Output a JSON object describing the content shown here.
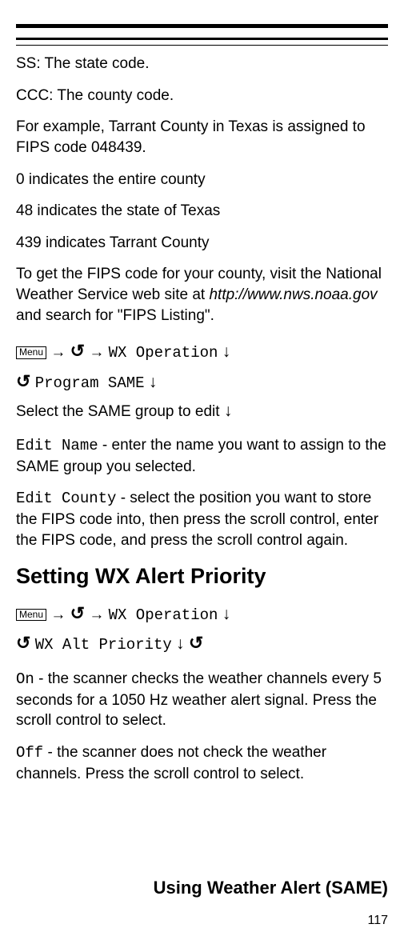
{
  "menu_label": "Menu",
  "body": {
    "p1": "SS: The state code.",
    "p2": "CCC: The county code.",
    "p3_a": "For example, Tarrant County in Texas is assigned to FIPS code 048439.",
    "p4": "0 indicates the entire county",
    "p5": "48 indicates the state of Texas",
    "p6": "439 indicates Tarrant County",
    "p7_a": "To get the FIPS code for your county, visit the National Weather Service web site at ",
    "p7_url": "http://www.nws.noaa.gov",
    "p7_b": " and search for \"FIPS Listing\"."
  },
  "nav1": {
    "wx_op": "WX Operation",
    "prog_same": "Program SAME",
    "select_group": "Select the SAME group to edit"
  },
  "edit_name": {
    "label": "Edit Name",
    "desc": " - enter the name you want to assign to the SAME group you selected."
  },
  "edit_county": {
    "label": "Edit County",
    "desc": " - select the position you want to store the FIPS code into, then press the scroll control, enter the FIPS code, and press the scroll control again."
  },
  "section_heading": "Setting WX Alert Priority",
  "nav2": {
    "wx_op": "WX Operation",
    "alt_pri": "WX Alt Priority"
  },
  "on": {
    "label": "On",
    "desc": " - the scanner checks the weather channels every 5 seconds for a 1050 Hz weather alert signal. Press the scroll control to select."
  },
  "off": {
    "label": "Off",
    "desc": " - the scanner does not check the weather channels. Press the scroll control to select."
  },
  "footer_title": "Using Weather Alert (SAME)",
  "page_number": "117",
  "glyphs": {
    "arrow_right": "→",
    "arrow_down": "↓",
    "refresh": "↺"
  }
}
